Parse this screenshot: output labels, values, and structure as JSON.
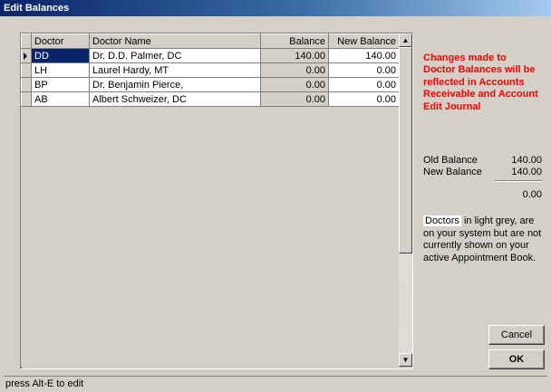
{
  "window": {
    "title": "Edit Balances"
  },
  "grid": {
    "columns": [
      "Doctor",
      "Doctor Name",
      "Balance",
      "New Balance"
    ],
    "rows": [
      {
        "code": "DD",
        "name": "Dr. D.D. Palmer, DC",
        "balance": "140.00",
        "new_balance": "140.00"
      },
      {
        "code": "LH",
        "name": "Laurel Hardy, MT",
        "balance": "0.00",
        "new_balance": "0.00"
      },
      {
        "code": "BP",
        "name": "Dr. Benjamin Pierce,",
        "balance": "0.00",
        "new_balance": "0.00"
      },
      {
        "code": "AB",
        "name": "Albert Schweizer, DC",
        "balance": "0.00",
        "new_balance": "0.00"
      }
    ],
    "selected_row_index": 0
  },
  "notice": {
    "text": "Changes made to Doctor Balances will be reflected in Accounts Receivable and Account Edit Journal"
  },
  "summary": {
    "old_label": "Old Balance",
    "old_value": "140.00",
    "new_label": "New Balance",
    "new_value": "140.00",
    "difference": "0.00"
  },
  "legend": {
    "chip": "Doctors",
    "text": " in light grey, are on your system but are not currently shown on your active Appointment Book."
  },
  "buttons": {
    "cancel": "Cancel",
    "ok": "OK"
  },
  "status": {
    "text": "press Alt-E to edit"
  },
  "colors": {
    "notice": "#ff0000",
    "selection": "#0a246a",
    "face": "#d4d0c8"
  },
  "icons": {
    "scroll_up": "triangle-up",
    "scroll_down": "triangle-down",
    "row_indicator": "triangle-right"
  }
}
